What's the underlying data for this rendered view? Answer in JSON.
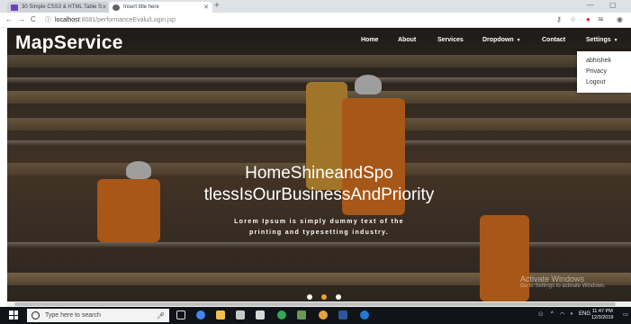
{
  "browser": {
    "tabs": [
      {
        "title": "30 Simple CSS3 & HTML Table S",
        "favicon_color": "#6f42c1",
        "active": false
      },
      {
        "title": "Insert title here",
        "favicon_color": "#5f6368",
        "active": true
      }
    ],
    "new_tab": "+",
    "url_host": "localhost",
    "url_path": ":8081/performanceEvalu/Login.jsp",
    "nav": {
      "back": "←",
      "forward": "→",
      "reload": "C"
    },
    "window": {
      "minimize": "—",
      "maximize": "▢"
    }
  },
  "site": {
    "brand": "MapService",
    "menu": [
      {
        "label": "Home"
      },
      {
        "label": "About"
      },
      {
        "label": "Services"
      },
      {
        "label": "Dropdown",
        "caret": "▼"
      },
      {
        "label": "Contact"
      },
      {
        "label": "Settings",
        "caret": "▼"
      }
    ],
    "settings_dropdown": [
      "abhishek",
      "Privacy",
      "Logout"
    ],
    "hero": {
      "headline_line1": "HomeShineandSpo",
      "headline_line2": "tlessIsOurBusinessAndPriority",
      "subtext_line1": "Lorem Ipsum is simply dummy text of the",
      "subtext_line2": "printing and typesetting industry.",
      "slides": 3,
      "active_slide": 2
    },
    "watermark": {
      "line1": "Activate Windows",
      "line2": "Go to Settings to activate Windows."
    }
  },
  "taskbar": {
    "search_placeholder": "Type here to search",
    "time": "11:47 PM",
    "date": "12/3/2019",
    "lang": "ENG"
  },
  "colors": {
    "accent_active_dot": "#f0a030",
    "taskbar": "#101318",
    "vest_orange": "#e87922"
  }
}
